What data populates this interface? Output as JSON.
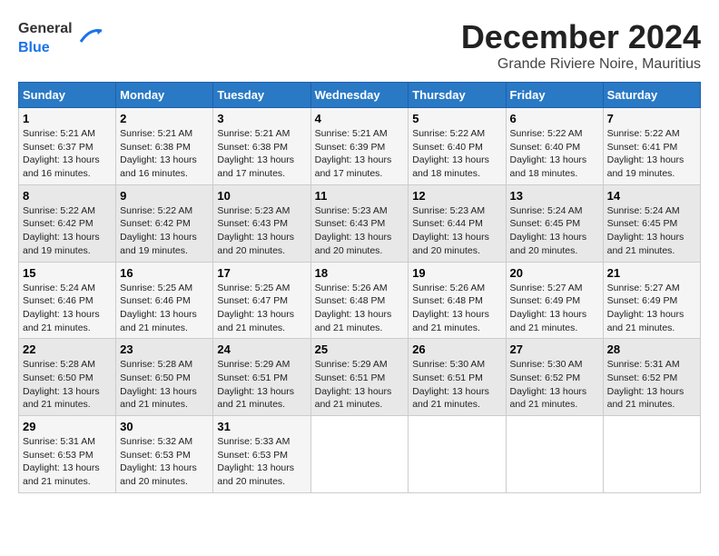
{
  "header": {
    "logo_general": "General",
    "logo_blue": "Blue",
    "month": "December 2024",
    "location": "Grande Riviere Noire, Mauritius"
  },
  "weekdays": [
    "Sunday",
    "Monday",
    "Tuesday",
    "Wednesday",
    "Thursday",
    "Friday",
    "Saturday"
  ],
  "weeks": [
    [
      {
        "day": "1",
        "sunrise": "5:21 AM",
        "sunset": "6:37 PM",
        "daylight": "13 hours and 16 minutes."
      },
      {
        "day": "2",
        "sunrise": "5:21 AM",
        "sunset": "6:38 PM",
        "daylight": "13 hours and 16 minutes."
      },
      {
        "day": "3",
        "sunrise": "5:21 AM",
        "sunset": "6:38 PM",
        "daylight": "13 hours and 17 minutes."
      },
      {
        "day": "4",
        "sunrise": "5:21 AM",
        "sunset": "6:39 PM",
        "daylight": "13 hours and 17 minutes."
      },
      {
        "day": "5",
        "sunrise": "5:22 AM",
        "sunset": "6:40 PM",
        "daylight": "13 hours and 18 minutes."
      },
      {
        "day": "6",
        "sunrise": "5:22 AM",
        "sunset": "6:40 PM",
        "daylight": "13 hours and 18 minutes."
      },
      {
        "day": "7",
        "sunrise": "5:22 AM",
        "sunset": "6:41 PM",
        "daylight": "13 hours and 19 minutes."
      }
    ],
    [
      {
        "day": "8",
        "sunrise": "5:22 AM",
        "sunset": "6:42 PM",
        "daylight": "13 hours and 19 minutes."
      },
      {
        "day": "9",
        "sunrise": "5:22 AM",
        "sunset": "6:42 PM",
        "daylight": "13 hours and 19 minutes."
      },
      {
        "day": "10",
        "sunrise": "5:23 AM",
        "sunset": "6:43 PM",
        "daylight": "13 hours and 20 minutes."
      },
      {
        "day": "11",
        "sunrise": "5:23 AM",
        "sunset": "6:43 PM",
        "daylight": "13 hours and 20 minutes."
      },
      {
        "day": "12",
        "sunrise": "5:23 AM",
        "sunset": "6:44 PM",
        "daylight": "13 hours and 20 minutes."
      },
      {
        "day": "13",
        "sunrise": "5:24 AM",
        "sunset": "6:45 PM",
        "daylight": "13 hours and 20 minutes."
      },
      {
        "day": "14",
        "sunrise": "5:24 AM",
        "sunset": "6:45 PM",
        "daylight": "13 hours and 21 minutes."
      }
    ],
    [
      {
        "day": "15",
        "sunrise": "5:24 AM",
        "sunset": "6:46 PM",
        "daylight": "13 hours and 21 minutes."
      },
      {
        "day": "16",
        "sunrise": "5:25 AM",
        "sunset": "6:46 PM",
        "daylight": "13 hours and 21 minutes."
      },
      {
        "day": "17",
        "sunrise": "5:25 AM",
        "sunset": "6:47 PM",
        "daylight": "13 hours and 21 minutes."
      },
      {
        "day": "18",
        "sunrise": "5:26 AM",
        "sunset": "6:48 PM",
        "daylight": "13 hours and 21 minutes."
      },
      {
        "day": "19",
        "sunrise": "5:26 AM",
        "sunset": "6:48 PM",
        "daylight": "13 hours and 21 minutes."
      },
      {
        "day": "20",
        "sunrise": "5:27 AM",
        "sunset": "6:49 PM",
        "daylight": "13 hours and 21 minutes."
      },
      {
        "day": "21",
        "sunrise": "5:27 AM",
        "sunset": "6:49 PM",
        "daylight": "13 hours and 21 minutes."
      }
    ],
    [
      {
        "day": "22",
        "sunrise": "5:28 AM",
        "sunset": "6:50 PM",
        "daylight": "13 hours and 21 minutes."
      },
      {
        "day": "23",
        "sunrise": "5:28 AM",
        "sunset": "6:50 PM",
        "daylight": "13 hours and 21 minutes."
      },
      {
        "day": "24",
        "sunrise": "5:29 AM",
        "sunset": "6:51 PM",
        "daylight": "13 hours and 21 minutes."
      },
      {
        "day": "25",
        "sunrise": "5:29 AM",
        "sunset": "6:51 PM",
        "daylight": "13 hours and 21 minutes."
      },
      {
        "day": "26",
        "sunrise": "5:30 AM",
        "sunset": "6:51 PM",
        "daylight": "13 hours and 21 minutes."
      },
      {
        "day": "27",
        "sunrise": "5:30 AM",
        "sunset": "6:52 PM",
        "daylight": "13 hours and 21 minutes."
      },
      {
        "day": "28",
        "sunrise": "5:31 AM",
        "sunset": "6:52 PM",
        "daylight": "13 hours and 21 minutes."
      }
    ],
    [
      {
        "day": "29",
        "sunrise": "5:31 AM",
        "sunset": "6:53 PM",
        "daylight": "13 hours and 21 minutes."
      },
      {
        "day": "30",
        "sunrise": "5:32 AM",
        "sunset": "6:53 PM",
        "daylight": "13 hours and 20 minutes."
      },
      {
        "day": "31",
        "sunrise": "5:33 AM",
        "sunset": "6:53 PM",
        "daylight": "13 hours and 20 minutes."
      },
      null,
      null,
      null,
      null
    ]
  ]
}
